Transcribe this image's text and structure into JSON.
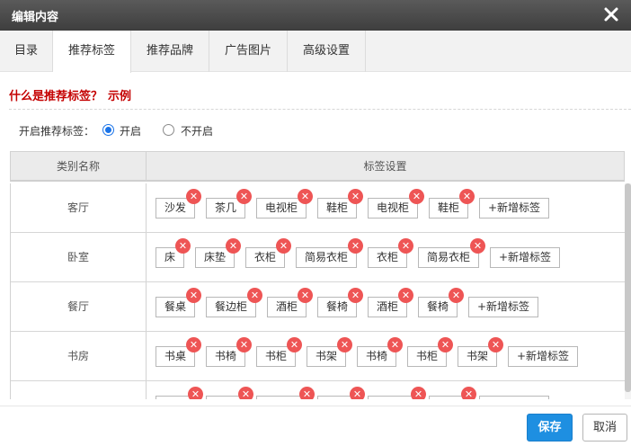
{
  "dialog": {
    "title": "编辑内容",
    "close_icon": "close-icon"
  },
  "tabs": [
    {
      "label": "目录",
      "active": false
    },
    {
      "label": "推荐标签",
      "active": true
    },
    {
      "label": "推荐品牌",
      "active": false
    },
    {
      "label": "广告图片",
      "active": false
    },
    {
      "label": "高级设置",
      "active": false
    }
  ],
  "help": {
    "question": "什么是推荐标签？",
    "example_link": "示例"
  },
  "toggle": {
    "label": "开启推荐标签：",
    "on_label": "开启",
    "off_label": "不开启",
    "selected": "开启"
  },
  "table": {
    "headers": [
      "类别名称",
      "标签设置"
    ],
    "add_tag_label": "+新增标签",
    "remove_icon": "remove-tag-icon",
    "rows": [
      {
        "category": "客厅",
        "tags": [
          "沙发",
          "茶几",
          "电视柜",
          "鞋柜",
          "电视柜",
          "鞋柜"
        ]
      },
      {
        "category": "卧室",
        "tags": [
          "床",
          "床垫",
          "衣柜",
          "简易衣柜",
          "衣柜",
          "简易衣柜"
        ]
      },
      {
        "category": "餐厅",
        "tags": [
          "餐桌",
          "餐边柜",
          "酒柜",
          "餐椅",
          "酒柜",
          "餐椅"
        ]
      },
      {
        "category": "书房",
        "tags": [
          "书桌",
          "书椅",
          "书柜",
          "书架",
          "书椅",
          "书柜",
          "书架"
        ]
      }
    ]
  },
  "footer": {
    "save_label": "保存",
    "cancel_label": "取消"
  },
  "colors": {
    "accent": "#1e8fe1",
    "help_red": "#c40000",
    "remove_badge": "#ee5555",
    "titlebar": "#4a4a4a"
  }
}
